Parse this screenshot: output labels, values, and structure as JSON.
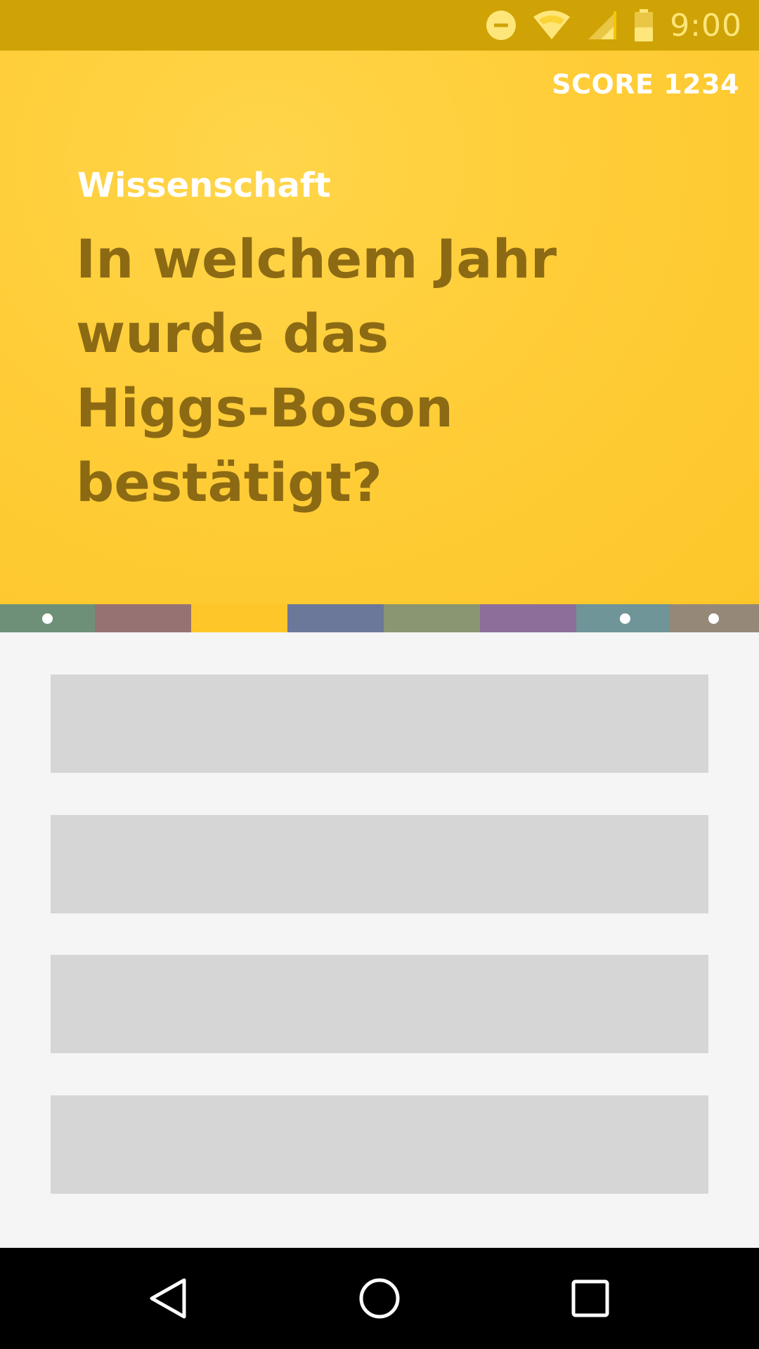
{
  "status_bar": {
    "time": "9:00",
    "icons": [
      "do-not-disturb-icon",
      "wifi-icon",
      "cell-signal-icon",
      "battery-icon"
    ],
    "background": "#cfa306"
  },
  "header": {
    "score_label": "SCORE 1234",
    "category": "Wissenschaft",
    "question": "In welchem Jahr wurde das Higgs-Boson bestätigt?",
    "background": "#ffcd38",
    "question_color": "#8c6a14"
  },
  "category_strip": {
    "segments": [
      {
        "color": "#6e9079",
        "dot": true
      },
      {
        "color": "#967272",
        "dot": false
      },
      {
        "color": "#fdc72a",
        "dot": false
      },
      {
        "color": "#6c7899",
        "dot": false
      },
      {
        "color": "#8a9672",
        "dot": false
      },
      {
        "color": "#8d6e9b",
        "dot": false
      },
      {
        "color": "#6f9599",
        "dot": true
      },
      {
        "color": "#968879",
        "dot": true
      }
    ]
  },
  "answers": {
    "count": 4,
    "placeholder_color": "#d6d6d6"
  },
  "nav_bar": {
    "buttons": [
      "back-icon",
      "home-icon",
      "recents-icon"
    ]
  }
}
